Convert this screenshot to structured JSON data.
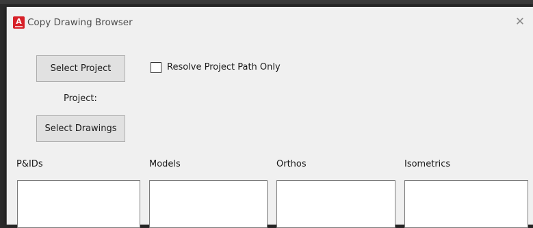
{
  "window": {
    "title": "Copy Drawing Browser",
    "app_icon": "autocad-icon",
    "close_glyph": "✕"
  },
  "buttons": {
    "select_project": "Select Project",
    "select_drawings": "Select Drawings"
  },
  "options": {
    "resolve_project_path_only": {
      "label": "Resolve Project Path Only",
      "checked": false
    }
  },
  "project": {
    "label": "Project:"
  },
  "groups": [
    {
      "label": "P&IDs"
    },
    {
      "label": "Models"
    },
    {
      "label": "Orthos"
    },
    {
      "label": "Isometrics"
    }
  ],
  "colors": {
    "window_bg": "#f0f0f0",
    "icon_red": "#d72028"
  }
}
